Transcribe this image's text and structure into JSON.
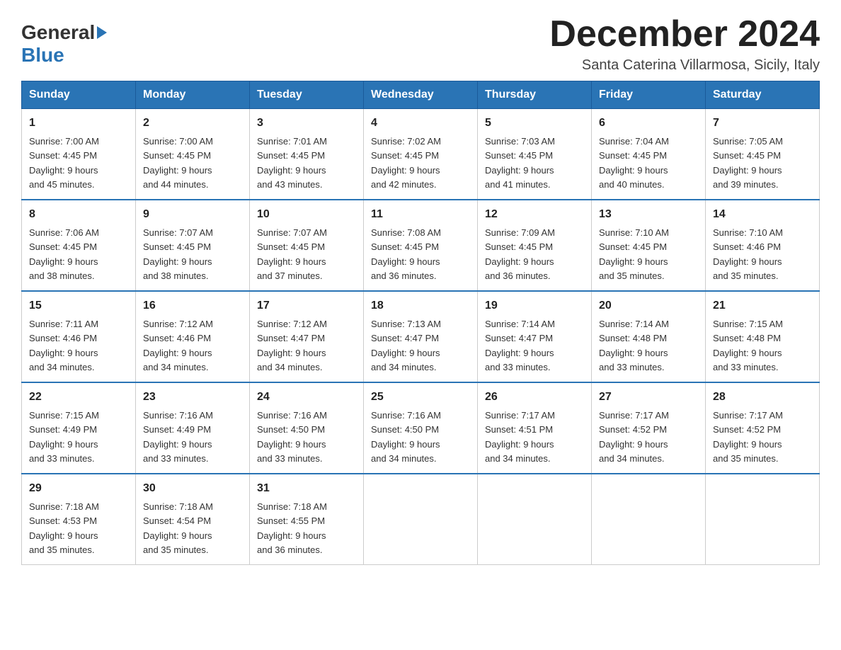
{
  "header": {
    "logo_general": "General",
    "logo_blue": "Blue",
    "month_title": "December 2024",
    "subtitle": "Santa Caterina Villarmosa, Sicily, Italy"
  },
  "days_of_week": [
    "Sunday",
    "Monday",
    "Tuesday",
    "Wednesday",
    "Thursday",
    "Friday",
    "Saturday"
  ],
  "weeks": [
    [
      {
        "day": "1",
        "sunrise": "7:00 AM",
        "sunset": "4:45 PM",
        "daylight": "9 hours and 45 minutes."
      },
      {
        "day": "2",
        "sunrise": "7:00 AM",
        "sunset": "4:45 PM",
        "daylight": "9 hours and 44 minutes."
      },
      {
        "day": "3",
        "sunrise": "7:01 AM",
        "sunset": "4:45 PM",
        "daylight": "9 hours and 43 minutes."
      },
      {
        "day": "4",
        "sunrise": "7:02 AM",
        "sunset": "4:45 PM",
        "daylight": "9 hours and 42 minutes."
      },
      {
        "day": "5",
        "sunrise": "7:03 AM",
        "sunset": "4:45 PM",
        "daylight": "9 hours and 41 minutes."
      },
      {
        "day": "6",
        "sunrise": "7:04 AM",
        "sunset": "4:45 PM",
        "daylight": "9 hours and 40 minutes."
      },
      {
        "day": "7",
        "sunrise": "7:05 AM",
        "sunset": "4:45 PM",
        "daylight": "9 hours and 39 minutes."
      }
    ],
    [
      {
        "day": "8",
        "sunrise": "7:06 AM",
        "sunset": "4:45 PM",
        "daylight": "9 hours and 38 minutes."
      },
      {
        "day": "9",
        "sunrise": "7:07 AM",
        "sunset": "4:45 PM",
        "daylight": "9 hours and 38 minutes."
      },
      {
        "day": "10",
        "sunrise": "7:07 AM",
        "sunset": "4:45 PM",
        "daylight": "9 hours and 37 minutes."
      },
      {
        "day": "11",
        "sunrise": "7:08 AM",
        "sunset": "4:45 PM",
        "daylight": "9 hours and 36 minutes."
      },
      {
        "day": "12",
        "sunrise": "7:09 AM",
        "sunset": "4:45 PM",
        "daylight": "9 hours and 36 minutes."
      },
      {
        "day": "13",
        "sunrise": "7:10 AM",
        "sunset": "4:45 PM",
        "daylight": "9 hours and 35 minutes."
      },
      {
        "day": "14",
        "sunrise": "7:10 AM",
        "sunset": "4:46 PM",
        "daylight": "9 hours and 35 minutes."
      }
    ],
    [
      {
        "day": "15",
        "sunrise": "7:11 AM",
        "sunset": "4:46 PM",
        "daylight": "9 hours and 34 minutes."
      },
      {
        "day": "16",
        "sunrise": "7:12 AM",
        "sunset": "4:46 PM",
        "daylight": "9 hours and 34 minutes."
      },
      {
        "day": "17",
        "sunrise": "7:12 AM",
        "sunset": "4:47 PM",
        "daylight": "9 hours and 34 minutes."
      },
      {
        "day": "18",
        "sunrise": "7:13 AM",
        "sunset": "4:47 PM",
        "daylight": "9 hours and 34 minutes."
      },
      {
        "day": "19",
        "sunrise": "7:14 AM",
        "sunset": "4:47 PM",
        "daylight": "9 hours and 33 minutes."
      },
      {
        "day": "20",
        "sunrise": "7:14 AM",
        "sunset": "4:48 PM",
        "daylight": "9 hours and 33 minutes."
      },
      {
        "day": "21",
        "sunrise": "7:15 AM",
        "sunset": "4:48 PM",
        "daylight": "9 hours and 33 minutes."
      }
    ],
    [
      {
        "day": "22",
        "sunrise": "7:15 AM",
        "sunset": "4:49 PM",
        "daylight": "9 hours and 33 minutes."
      },
      {
        "day": "23",
        "sunrise": "7:16 AM",
        "sunset": "4:49 PM",
        "daylight": "9 hours and 33 minutes."
      },
      {
        "day": "24",
        "sunrise": "7:16 AM",
        "sunset": "4:50 PM",
        "daylight": "9 hours and 33 minutes."
      },
      {
        "day": "25",
        "sunrise": "7:16 AM",
        "sunset": "4:50 PM",
        "daylight": "9 hours and 34 minutes."
      },
      {
        "day": "26",
        "sunrise": "7:17 AM",
        "sunset": "4:51 PM",
        "daylight": "9 hours and 34 minutes."
      },
      {
        "day": "27",
        "sunrise": "7:17 AM",
        "sunset": "4:52 PM",
        "daylight": "9 hours and 34 minutes."
      },
      {
        "day": "28",
        "sunrise": "7:17 AM",
        "sunset": "4:52 PM",
        "daylight": "9 hours and 35 minutes."
      }
    ],
    [
      {
        "day": "29",
        "sunrise": "7:18 AM",
        "sunset": "4:53 PM",
        "daylight": "9 hours and 35 minutes."
      },
      {
        "day": "30",
        "sunrise": "7:18 AM",
        "sunset": "4:54 PM",
        "daylight": "9 hours and 35 minutes."
      },
      {
        "day": "31",
        "sunrise": "7:18 AM",
        "sunset": "4:55 PM",
        "daylight": "9 hours and 36 minutes."
      },
      null,
      null,
      null,
      null
    ]
  ],
  "labels": {
    "sunrise": "Sunrise:",
    "sunset": "Sunset:",
    "daylight": "Daylight:"
  }
}
